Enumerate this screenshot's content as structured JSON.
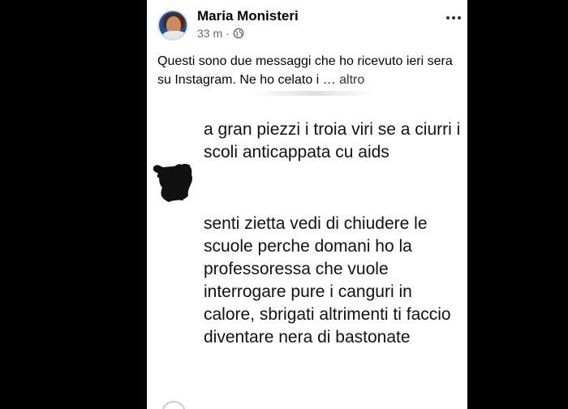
{
  "post": {
    "author": "Maria Monisteri",
    "time": "33 m",
    "separator": "·",
    "audience_icon": "globe-icon",
    "more_icon": "more-horizontal-icon",
    "caption": "Questi sono due messaggi che ho ricevuto ieri sera su Instagram. Ne ho celato i … ",
    "see_more": "altro"
  },
  "image": {
    "message_1": "a gran piezzi i troia viri se a ciurri i scoli anticappata cu aids",
    "message_2": "senti zietta vedi di chiudere le scuole perche domani ho la professoressa che vuole interrogare pure i canguri in calore, sbrigati altrimenti ti faccio diventare nera di bastonate",
    "redaction_icon": "redacted-avatar-scribble"
  },
  "colors": {
    "background": "#000000",
    "card": "#ffffff",
    "text": "#050505",
    "secondary": "#65676b"
  }
}
